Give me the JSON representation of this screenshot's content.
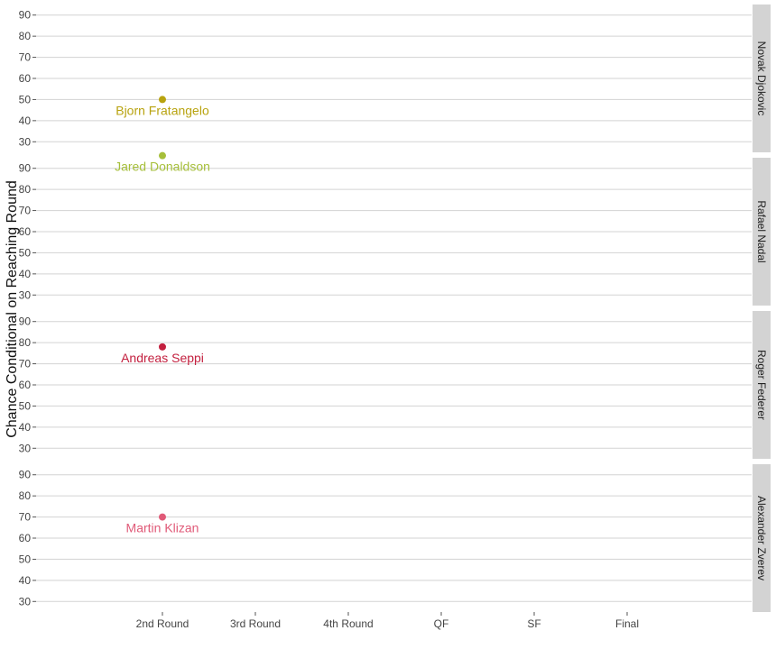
{
  "chart_data": {
    "type": "scatter",
    "ylabel": "Chance Conditional on Reaching Round",
    "xlabel": "",
    "categories": [
      "2nd Round",
      "3rd Round",
      "4th Round",
      "QF",
      "SF",
      "Final"
    ],
    "y_ticks": [
      30,
      40,
      50,
      60,
      70,
      80,
      90
    ],
    "ylim": [
      25,
      95
    ],
    "grid": true,
    "facets": [
      {
        "label": "Novak Djokovic",
        "points": [
          {
            "round": "2nd Round",
            "value": 50,
            "player": "Bjorn Fratangelo",
            "color": "#b8a30f"
          }
        ]
      },
      {
        "label": "Rafael Nadal",
        "points": [
          {
            "round": "2nd Round",
            "value": 96,
            "player": "Jared Donaldson",
            "color": "#a6bf3a"
          }
        ]
      },
      {
        "label": "Roger Federer",
        "points": [
          {
            "round": "2nd Round",
            "value": 78,
            "player": "Andreas Seppi",
            "color": "#c3203f"
          }
        ]
      },
      {
        "label": "Alexander Zverev",
        "points": [
          {
            "round": "2nd Round",
            "value": 70,
            "player": "Martin Klizan",
            "color": "#e05a78"
          }
        ]
      }
    ]
  }
}
